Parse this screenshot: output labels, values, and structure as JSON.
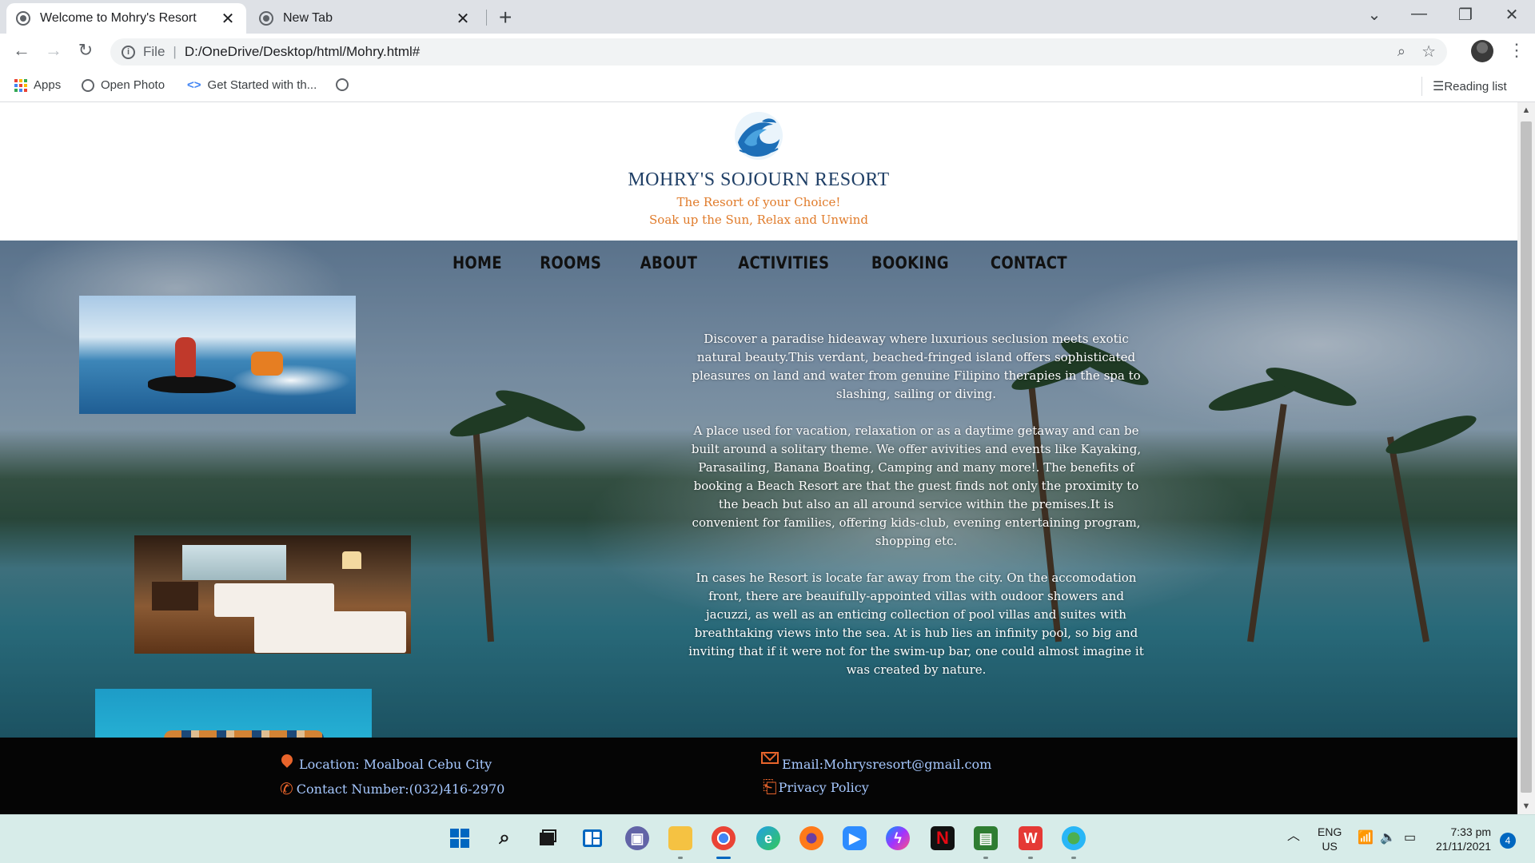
{
  "browser": {
    "tabs": [
      {
        "title": "Welcome to Mohry's Resort",
        "active": true
      },
      {
        "title": "New Tab",
        "active": false
      }
    ],
    "address": {
      "scheme": "File",
      "url": "D:/OneDrive/Desktop/html/Mohry.html#"
    },
    "bookmarks": [
      {
        "label": "Apps",
        "icon": "apps-grid-icon"
      },
      {
        "label": "Open Photo",
        "icon": "globe-icon"
      },
      {
        "label": "Get Started with th...",
        "icon": "code-icon"
      },
      {
        "label": "",
        "icon": "globe-icon"
      }
    ],
    "reading_list": "Reading list"
  },
  "site": {
    "title": "MOHRY'S SOJOURN RESORT",
    "tagline1": "The Resort of your Choice!",
    "tagline2": "Soak up the Sun, Relax and Unwind",
    "nav": [
      "HOME",
      "ROOMS",
      "ABOUT",
      "ACTIVITIES",
      "BOOKING",
      "CONTACT"
    ],
    "paragraphs": [
      "Discover a paradise hideaway where luxurious seclusion meets exotic natural beauty.This verdant, beached-fringed island offers sophisticated pleasures on land and water from genuine Filipino therapies in the spa to slashing, sailing or diving.",
      "A place used for vacation, relaxation or as a daytime getaway and can be built around a solitary theme. We offer avivities and events like Kayaking, Parasailing, Banana Boating, Camping and many more!. The benefits of booking a Beach Resort are that the guest finds not only the proximity to the beach but also an all around service within the premises.It is convenient for families, offering kids-club, evening entertaining program, shopping etc.",
      "In cases he Resort is locate far away from the city. On the accomodation front, there are beauifully-appointed villas with oudoor showers and jacuzzi, as well as an enticing collection of pool villas and suites with breathtaking views into the sea. At is hub lies an infinity pool, so big and inviting that if it were not for the swim-up bar, one could almost imagine it was created by nature."
    ],
    "footer": {
      "location": "Location: Moalboal Cebu City",
      "contact": "Contact Number:(032)416-2970",
      "email": "Email:Mohrysresort@gmail.com",
      "policy": "Privacy Policy"
    }
  },
  "taskbar": {
    "lang": "ENG",
    "region": "US",
    "time": "7:33 pm",
    "date": "21/11/2021",
    "notifications": "4"
  },
  "colors": {
    "title": "#1f3f66",
    "tagline": "#e07b2a",
    "footer_text": "#a6c8ff",
    "footer_icons": "#e8642b"
  }
}
